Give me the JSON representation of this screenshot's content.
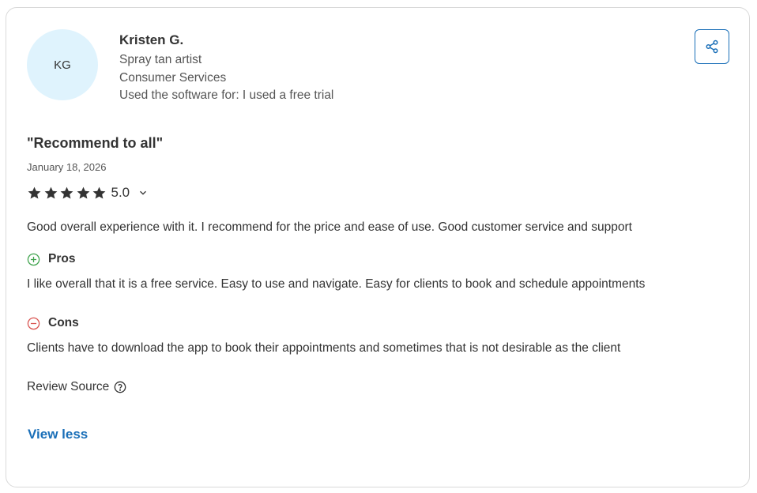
{
  "reviewer": {
    "initials": "KG",
    "name": "Kristen G.",
    "role": "Spray tan artist",
    "industry": "Consumer Services",
    "usage": "Used the software for: I used a free trial"
  },
  "review": {
    "title": "\"Recommend to all\"",
    "date": "January 18, 2026",
    "rating": "5.0",
    "stars": 5,
    "summary": "Good overall experience with it. I recommend for the price and ease of use. Good customer service and support",
    "pros_label": "Pros",
    "pros_text": "I like overall that it is a free service. Easy to use and navigate. Easy for clients to book and schedule appointments",
    "cons_label": "Cons",
    "cons_text": "Clients have to download the app to book their appointments and sometimes that is not desirable as the client",
    "source_label": "Review Source"
  },
  "actions": {
    "view_less": "View less",
    "share_icon": "share-icon"
  },
  "colors": {
    "accent": "#1a6fb8",
    "avatar_bg": "#dff3fd",
    "pros": "#3fa34d",
    "cons": "#d9534f",
    "star": "#333333"
  }
}
